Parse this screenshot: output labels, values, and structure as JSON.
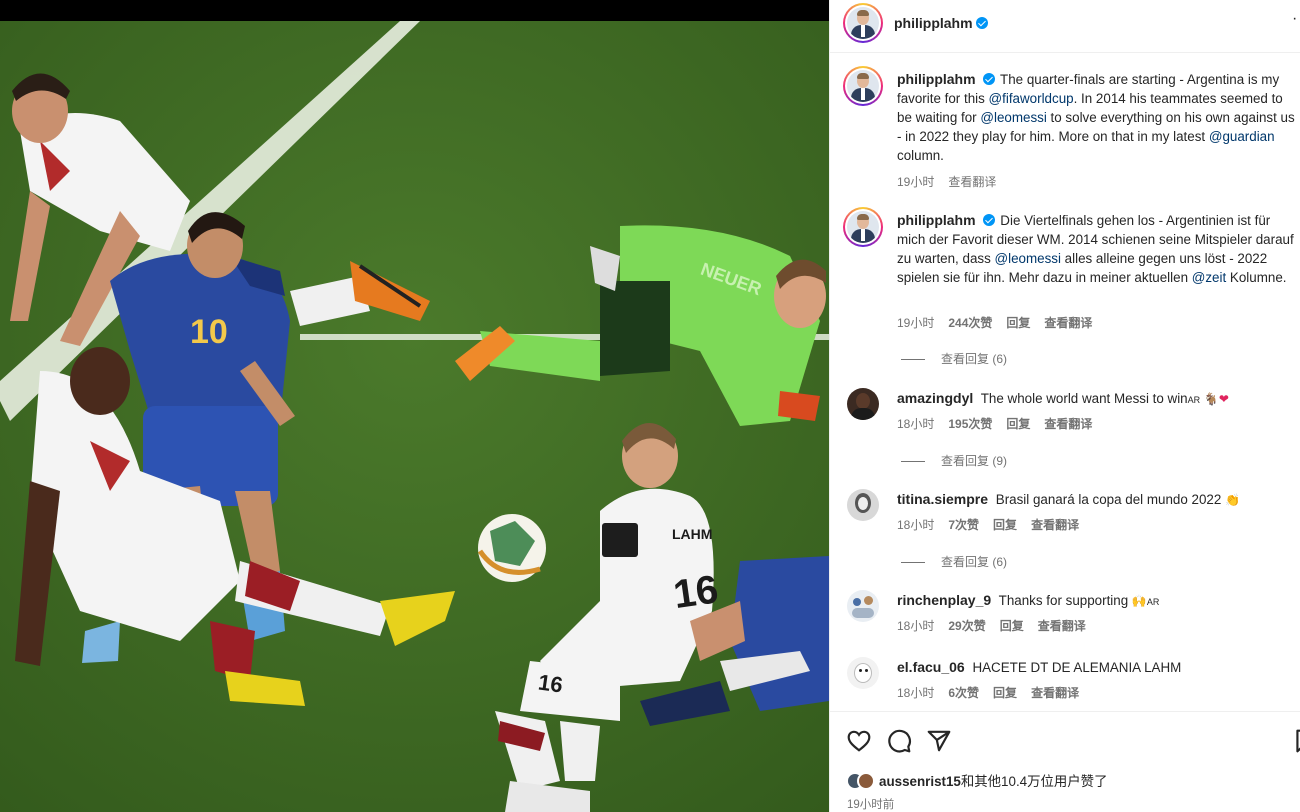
{
  "post": {
    "author": "philipplahm",
    "more_label": "···"
  },
  "comments": [
    {
      "user": "philipplahm",
      "verified": true,
      "segments": [
        "The quarter-finals are starting - Argentina is my favorite for this ",
        "@fifaworldcup",
        ". In 2014 his teammates seemed to be waiting for ",
        "@leomessi",
        " to solve everything on his own against us - in 2022 they play for him. More on that in my latest ",
        "@guardian",
        " column."
      ],
      "time": "19小时",
      "translate": "查看翻译"
    },
    {
      "user": "philipplahm",
      "verified": true,
      "segments": [
        "Die Viertelfinals gehen los - Argentinien ist für mich der Favorit dieser WM. 2014 schienen seine Mitspieler darauf zu warten, dass ",
        "@leomessi",
        " alles alleine gegen uns löst - 2022 spielen sie für ihn. Mehr dazu in meiner aktuellen ",
        "@zeit",
        " Kolumne."
      ],
      "time": "19小时",
      "likes": "244次赞",
      "reply": "回复",
      "translate": "查看翻译",
      "view_replies": "查看回复 (6)"
    },
    {
      "user": "amazingdyl",
      "text": "The whole world want Messi to win",
      "text_suffix": "AR",
      "time": "18小时",
      "likes": "195次赞",
      "reply": "回复",
      "translate": "查看翻译",
      "view_replies": "查看回复 (9)"
    },
    {
      "user": "titina.siempre",
      "text": "Brasil ganará la copa del mundo 2022",
      "time": "18小时",
      "likes": "7次赞",
      "reply": "回复",
      "translate": "查看翻译",
      "view_replies": "查看回复 (6)"
    },
    {
      "user": "rinchenplay_9",
      "text": "Thanks for supporting",
      "text_suffix": "AR",
      "time": "18小时",
      "likes": "29次赞",
      "reply": "回复",
      "translate": "查看翻译"
    },
    {
      "user": "el.facu_06",
      "text": "HACETE DT DE ALEMANIA LAHM",
      "time": "18小时",
      "likes": "6次赞",
      "reply": "回复",
      "translate": "查看翻译"
    }
  ],
  "likes_summary": {
    "user": "aussenrist15",
    "rest": "和其他10.4万位用户赞了"
  },
  "timestamp": "19小时前",
  "photo": {
    "jersey_messi": "10",
    "jersey_lahm": "16",
    "jersey_lahm_shorts": "16",
    "lahm_name": "LAHM",
    "neuer_name": "NEUER"
  },
  "colors": {
    "pitch": "#3f6d24",
    "argentina_kit": "#2a4aa0",
    "keeper_kit": "#7ed957",
    "link": "#00376b",
    "verified": "#0095f6"
  }
}
